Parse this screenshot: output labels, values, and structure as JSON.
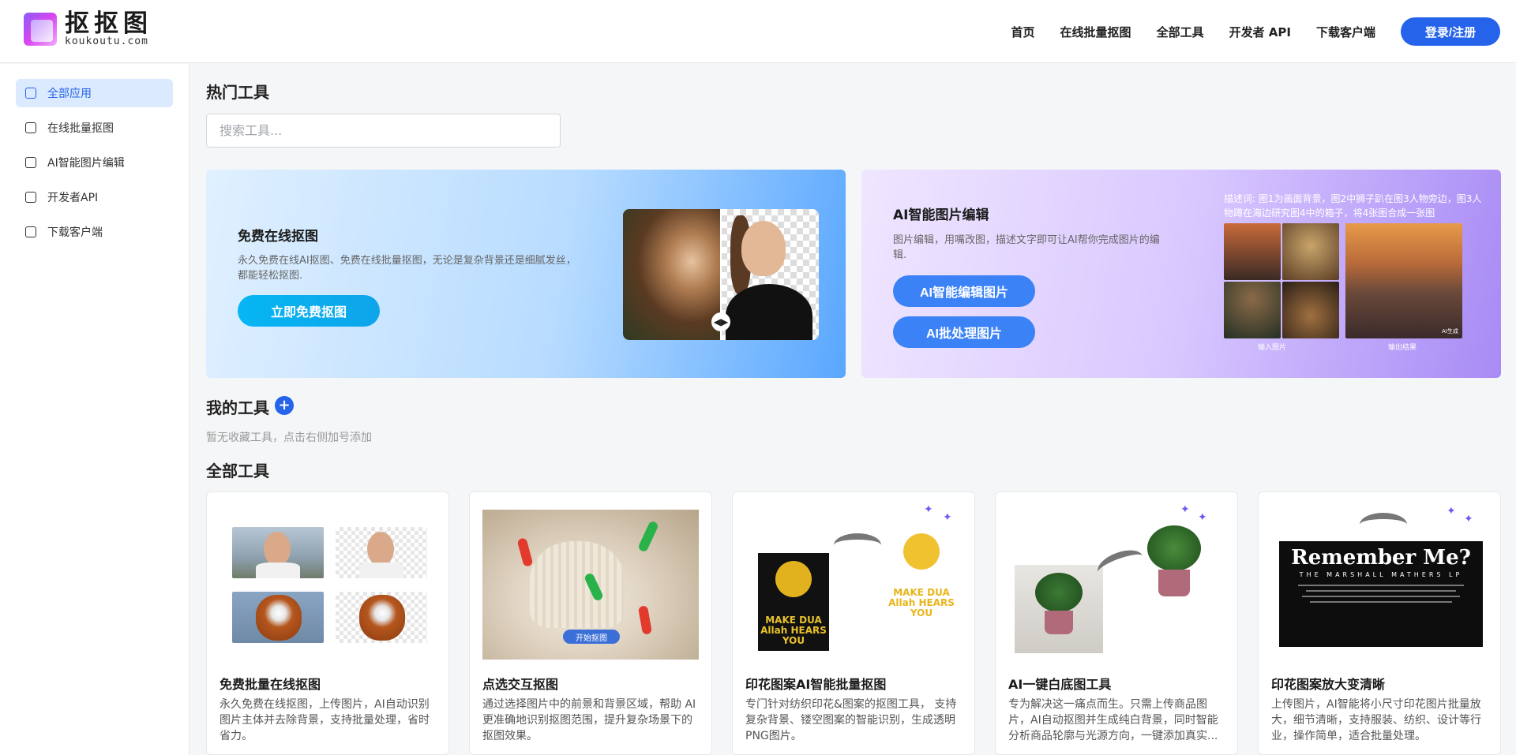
{
  "header": {
    "logo_cn": "抠抠图",
    "logo_en": "koukoutu.com",
    "nav": [
      "首页",
      "在线批量抠图",
      "全部工具",
      "开发者 API",
      "下载客户端"
    ],
    "login_label": "登录/注册"
  },
  "sidebar": {
    "items": [
      {
        "label": "全部应用",
        "icon": "home-icon"
      },
      {
        "label": "在线批量抠图",
        "icon": "portrait-icon"
      },
      {
        "label": "AI智能图片编辑",
        "icon": "edit-icon"
      },
      {
        "label": "开发者API",
        "icon": "api-icon"
      },
      {
        "label": "下载客户端",
        "icon": "download-icon"
      }
    ]
  },
  "main": {
    "hot_title": "热门工具",
    "search_placeholder": "搜索工具...",
    "banner_left": {
      "title": "免费在线抠图",
      "desc": "永久免费在线AI抠图、免费在线批量抠图，无论是复杂背景还是细腻发丝，都能轻松抠图.",
      "button": "立即免费抠图"
    },
    "banner_right": {
      "title": "AI智能图片编辑",
      "desc": "图片编辑，用嘴改图，描述文字即可让AI帮你完成图片的编辑.",
      "button1": "AI智能编辑图片",
      "button2": "AI批处理图片",
      "caption": "描述词: 图1为画面背景，图2中狮子趴在图3人物旁边，图3人物蹲在海边研究图4中的箱子，将4张图合成一张图",
      "input_label": "输入图片",
      "output_label": "输出结果",
      "ai_tag": "AI生成"
    },
    "my_tools_title": "我的工具",
    "my_tools_empty": "暂无收藏工具，点击右侧加号添加",
    "all_tools_title": "全部工具",
    "cards": [
      {
        "title": "免费批量在线抠图",
        "desc": "永久免费在线抠图，上传图片，AI自动识别图片主体并去除背景，支持批量处理，省时省力。"
      },
      {
        "title": "点选交互抠图",
        "desc": "通过选择图片中的前景和背景区域，帮助 AI 更准确地识别抠图范围，提升复杂场景下的抠图效果。",
        "overlay": "开始抠图"
      },
      {
        "title": "印花图案AI智能批量抠图",
        "desc": "专门针对纺织印花&图案的抠图工具， 支持复杂背景、镂空图案的智能识别，生成透明PNG图片。",
        "art_text": "MAKE DUA Allah HEARS YOU"
      },
      {
        "title": "AI一键白底图工具",
        "desc": "专为解决这一痛点而生。只需上传商品图片，AI自动抠图并生成纯白背景，同时智能分析商品轮廓与光源方向，一键添加真实..."
      },
      {
        "title": "印花图案放大变清晰",
        "desc": "上传图片，AI智能将小尺寸印花图片批量放大，细节清晰，支持服装、纺织、设计等行业，操作简单，适合批量处理。",
        "art_title": "Remember Me?",
        "art_sub": "THE MARSHALL MATHERS LP"
      }
    ]
  },
  "colors": {
    "accent": "#2563eb",
    "sidebar_active_bg": "#dbeafe",
    "cyan_button": "#0ea5e9"
  }
}
